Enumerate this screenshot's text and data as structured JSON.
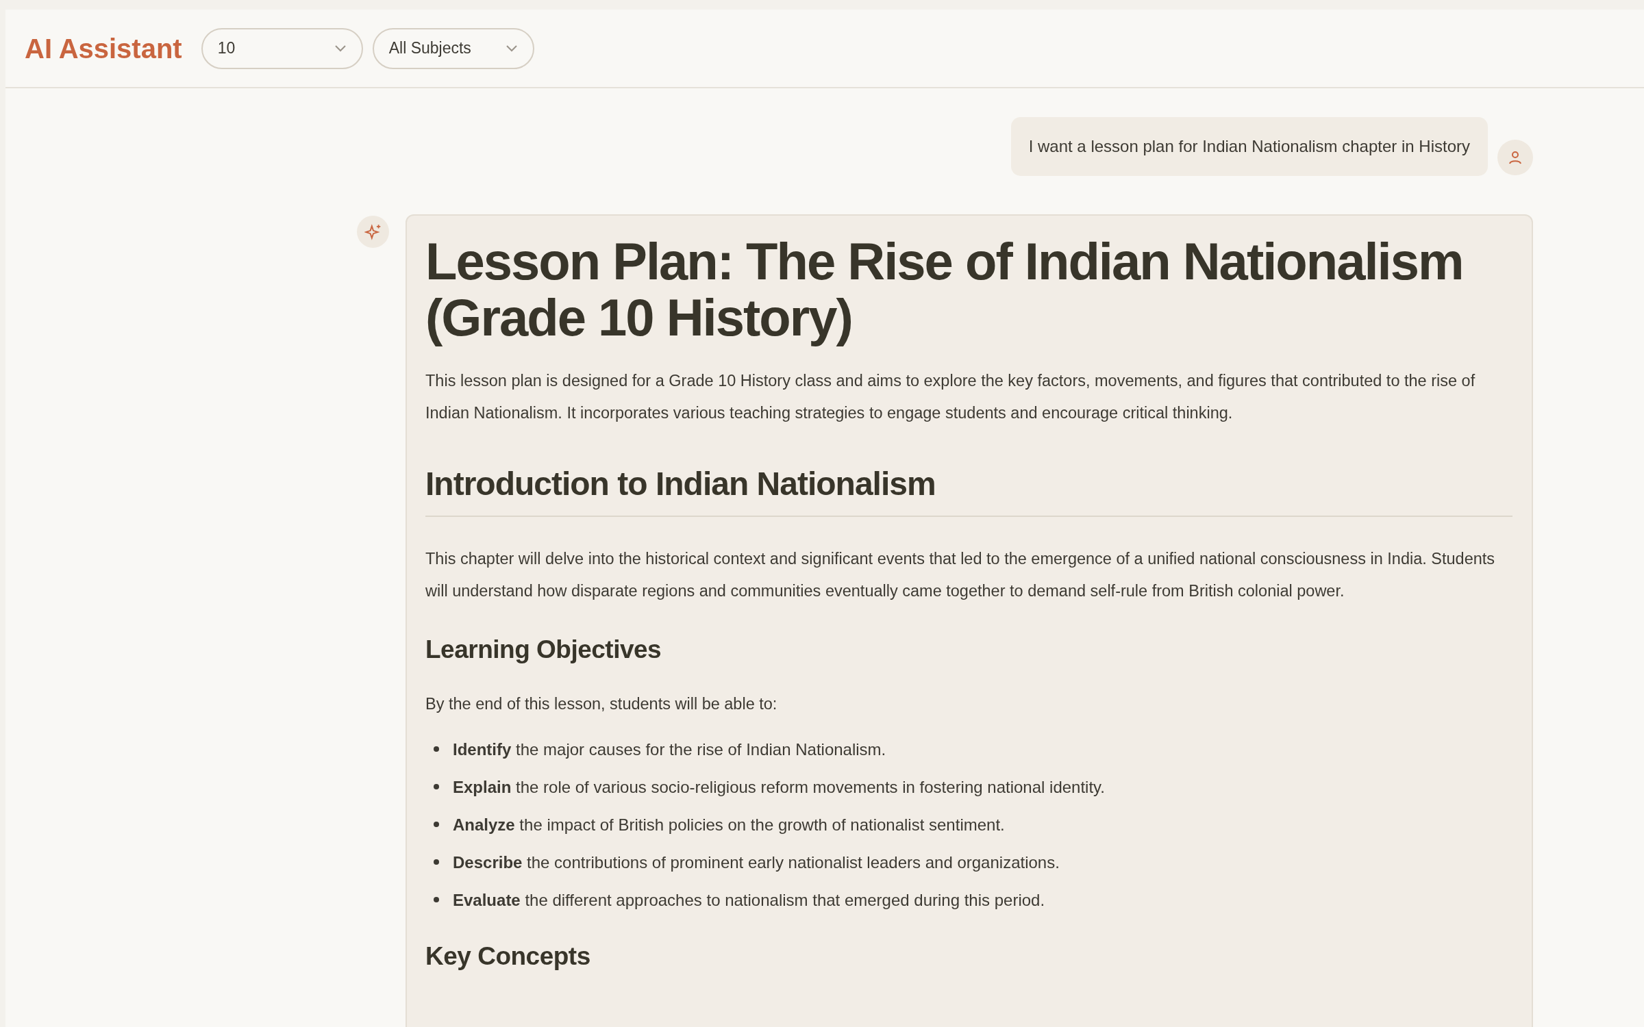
{
  "header": {
    "title": "AI Assistant",
    "grade_select": {
      "value": "10"
    },
    "subject_select": {
      "value": "All Subjects"
    }
  },
  "messages": [
    {
      "kind": "user",
      "text": "I want a lesson plan for Indian Nationalism chapter in History"
    },
    {
      "kind": "assistant",
      "blocks": [
        {
          "kind": "h1",
          "text": "Lesson Plan: The Rise of Indian Nationalism (Grade 10 History)"
        },
        {
          "kind": "p",
          "text": "This lesson plan is designed for a Grade 10 History class and aims to explore the key factors, movements, and figures that contributed to the rise of Indian Nationalism. It incorporates various teaching strategies to engage students and encourage critical thinking."
        },
        {
          "kind": "h2",
          "text": "Introduction to Indian Nationalism"
        },
        {
          "kind": "p",
          "text": "This chapter will delve into the historical context and significant events that led to the emergence of a unified national consciousness in India. Students will understand how disparate regions and communities eventually came together to demand self-rule from British colonial power."
        },
        {
          "kind": "h3",
          "text": "Learning Objectives"
        },
        {
          "kind": "p",
          "text": "By the end of this lesson, students will be able to:"
        },
        {
          "kind": "list",
          "items": [
            "**Identify** the major causes for the rise of Indian Nationalism.",
            "**Explain** the role of various socio-religious reform movements in fostering national identity.",
            "**Analyze** the impact of British policies on the growth of nationalist sentiment.",
            "**Describe** the contributions of prominent early nationalist leaders and organizations.",
            "**Evaluate** the different approaches to nationalism that emerged during this period."
          ]
        },
        {
          "kind": "h3",
          "text": "Key Concepts"
        }
      ]
    }
  ]
}
